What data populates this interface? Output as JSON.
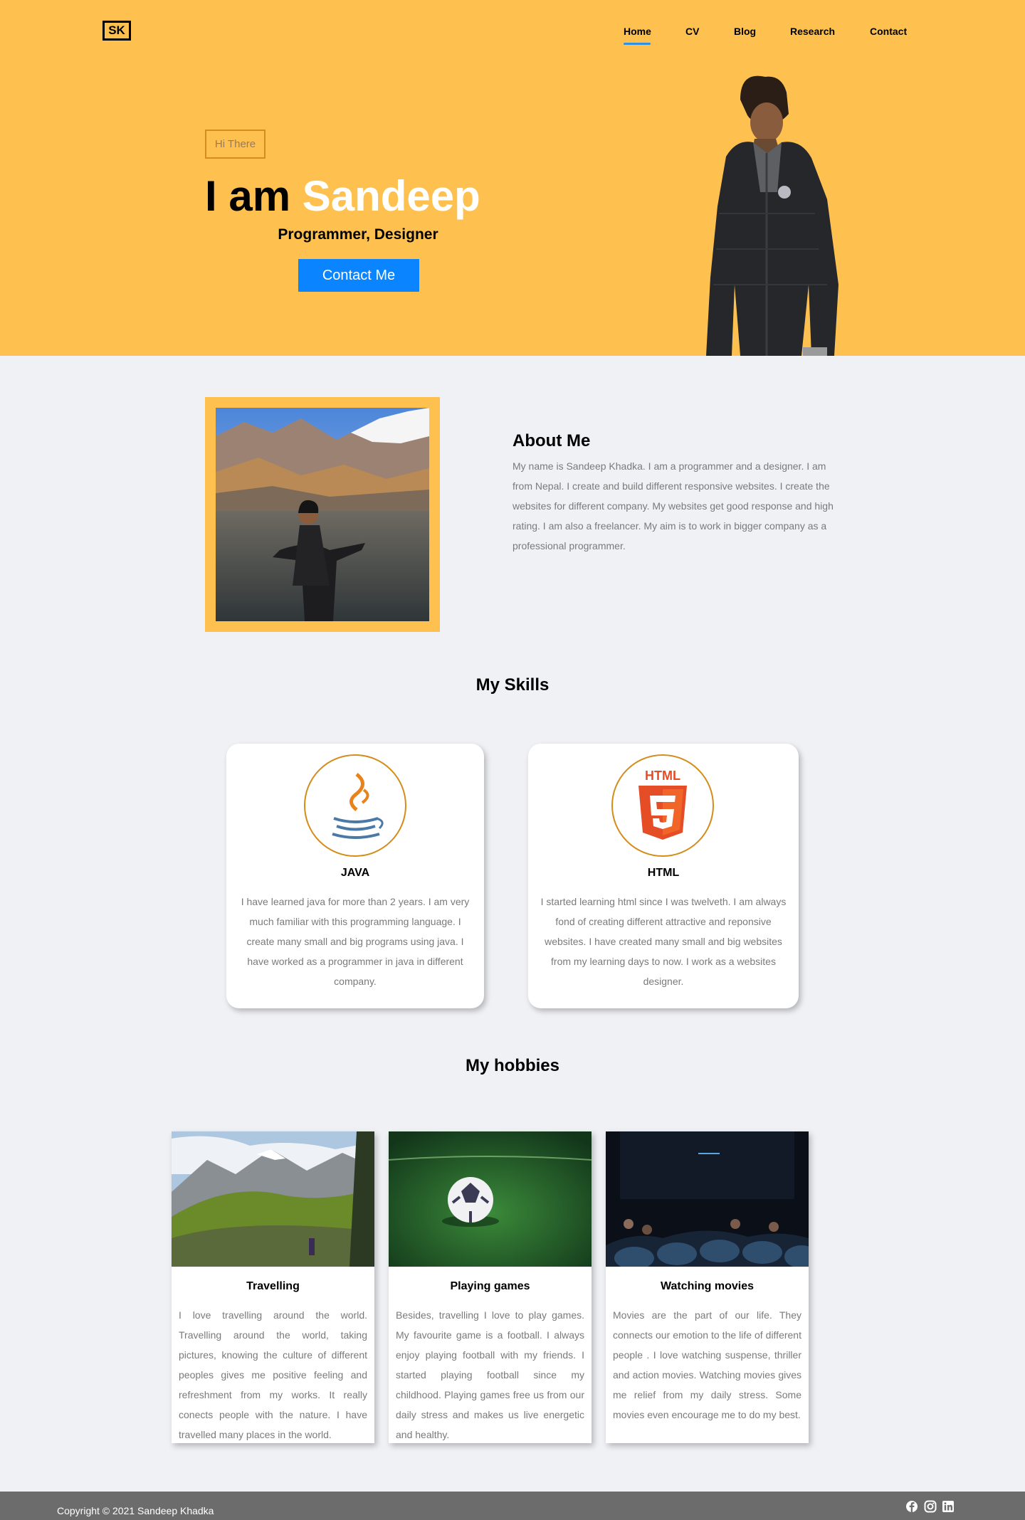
{
  "header": {
    "logo": "SK",
    "nav": [
      {
        "label": "Home",
        "active": true
      },
      {
        "label": "CV"
      },
      {
        "label": "Blog"
      },
      {
        "label": "Research"
      },
      {
        "label": "Contact"
      }
    ]
  },
  "hero": {
    "greeting": "Hi There",
    "headline_prefix": "I am",
    "headline_name": "Sandeep",
    "subtitle": "Programmer, Designer",
    "button": "Contact Me"
  },
  "about": {
    "title": "About Me",
    "text": "My name is Sandeep Khadka. I am a programmer and a designer. I am from Nepal. I create and build different responsive websites. I create the websites for different company. My websites get good response and high rating. I am also a freelancer. My aim is to work in bigger company as a professional programmer."
  },
  "skills": {
    "title": "My Skills",
    "items": [
      {
        "name": "JAVA",
        "icon": "java-icon",
        "text": "I have learned java for more than 2 years. I am very much familiar with this programming language. I create many small and big programs using java. I have worked as a programmer in java in different company."
      },
      {
        "name": "HTML",
        "icon": "html5-icon",
        "icon_text": "HTML",
        "text": "I started learning html since I was twelveth. I am always fond of creating different attractive and reponsive websites. I have created many small and big websites from my learning days to now. I work as a websites designer."
      }
    ]
  },
  "hobbies": {
    "title": "My hobbies",
    "items": [
      {
        "name": "Travelling",
        "text": "I love travelling around the world. Travelling around the world, taking pictures, knowing the culture of different peoples gives me positive feeling and refreshment from my works. It really conects people with the nature. I have travelled many places in the world."
      },
      {
        "name": "Playing games",
        "text": "Besides, travelling I love to play games. My favourite game is a football. I always enjoy playing football with my friends. I started playing football since my childhood. Playing games free us from our daily stress and makes us live energetic and healthy."
      },
      {
        "name": "Watching movies",
        "text": "Movies are the part of our life. They connects our emotion to the life of different people . I love watching suspense, thriller and action movies. Watching movies gives me relief from my daily stress. Some movies even encourage me to do my best."
      }
    ]
  },
  "footer": {
    "copyright": "Copyright © 2021 Sandeep Khadka",
    "social": [
      "facebook-icon",
      "instagram-icon",
      "linkedin-icon"
    ]
  },
  "colors": {
    "accent": "#fec150",
    "button": "#0a84ff",
    "background": "#f0f1f5",
    "footer": "#6c6c6c"
  }
}
